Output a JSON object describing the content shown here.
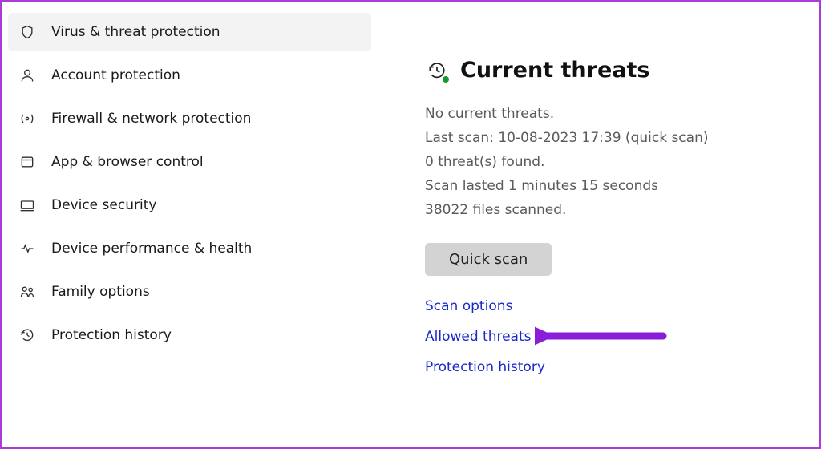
{
  "sidebar": {
    "items": [
      {
        "label": "Virus & threat protection",
        "icon": "shield-icon",
        "active": true
      },
      {
        "label": "Account protection",
        "icon": "account-icon",
        "active": false
      },
      {
        "label": "Firewall & network protection",
        "icon": "firewall-icon",
        "active": false
      },
      {
        "label": "App & browser control",
        "icon": "app-browser-icon",
        "active": false
      },
      {
        "label": "Device security",
        "icon": "device-icon",
        "active": false
      },
      {
        "label": "Device performance & health",
        "icon": "health-icon",
        "active": false
      },
      {
        "label": "Family options",
        "icon": "family-icon",
        "active": false
      },
      {
        "label": "Protection history",
        "icon": "history-icon",
        "active": false
      }
    ]
  },
  "main": {
    "section_title": "Current threats",
    "status": {
      "line1": "No current threats.",
      "line2": "Last scan: 10-08-2023 17:39 (quick scan)",
      "line3": "0 threat(s) found.",
      "line4": "Scan lasted 1 minutes 15 seconds",
      "line5": "38022 files scanned."
    },
    "quick_scan_label": "Quick scan",
    "links": {
      "scan_options": "Scan options",
      "allowed_threats": "Allowed threats",
      "protection_history": "Protection history"
    }
  },
  "annotation": {
    "arrow_color": "#8a1dd8",
    "target": "scan-options-link"
  }
}
